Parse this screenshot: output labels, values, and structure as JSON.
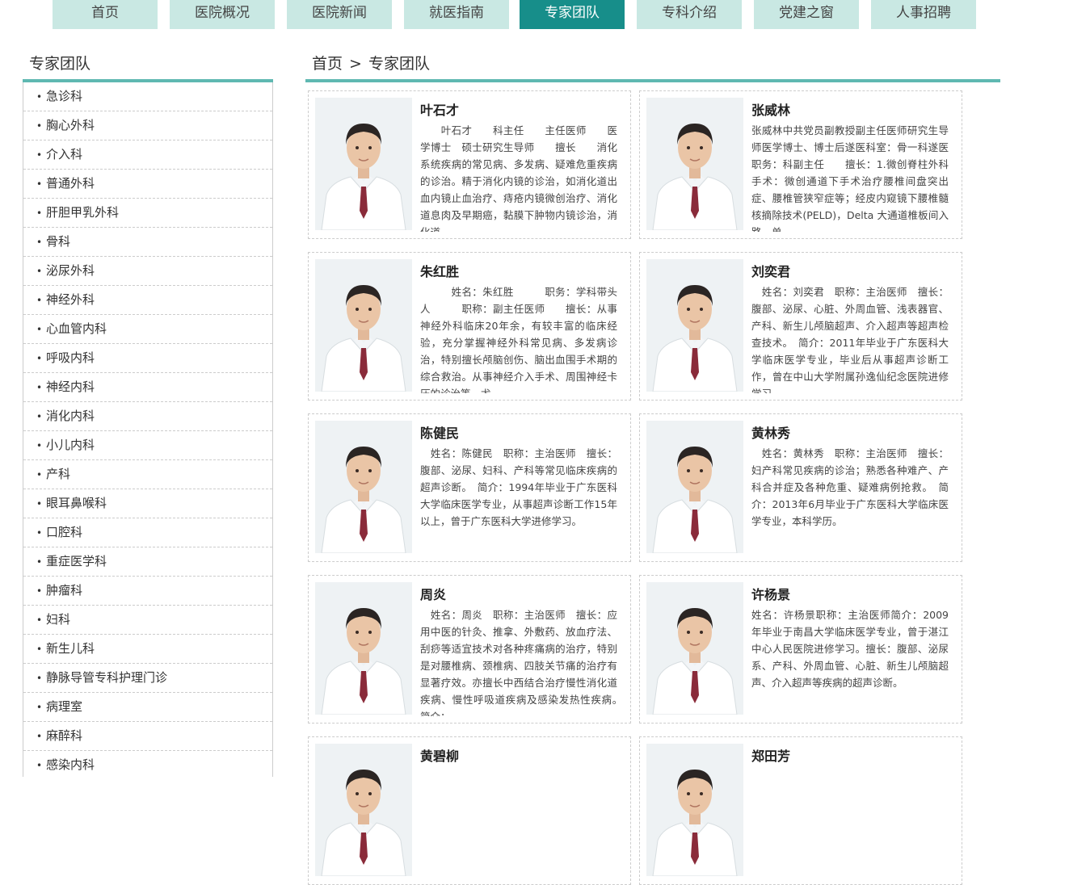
{
  "nav": {
    "items": [
      "首页",
      "医院概况",
      "医院新闻",
      "就医指南",
      "专家团队",
      "专科介绍",
      "党建之窗",
      "人事招聘"
    ],
    "active_index": 4
  },
  "sidebar": {
    "title": "专家团队",
    "items": [
      "急诊科",
      "胸心外科",
      "介入科",
      "普通外科",
      "肝胆甲乳外科",
      "骨科",
      "泌尿外科",
      "神经外科",
      "心血管内科",
      "呼吸内科",
      "神经内科",
      "消化内科",
      "小儿内科",
      "产科",
      "眼耳鼻喉科",
      "口腔科",
      "重症医学科",
      "肿瘤科",
      "妇科",
      "新生儿科",
      "静脉导管专科护理门诊",
      "病理室",
      "麻醉科",
      "感染内科"
    ]
  },
  "breadcrumb": {
    "home": "首页",
    "separator": ">",
    "current": "专家团队"
  },
  "doctors": [
    {
      "name": "叶石才",
      "desc": "　　叶石才　　科主任　　主任医师　　医学博士　硕士研究生导师　　擅长　　消化系统疾病的常见病、多发病、疑难危重疾病的诊治。精于消化内镜的诊治，如消化道出血内镜止血治疗、痔疮内镜微创治疗、消化道息肉及早期癌，黏膜下肿物内镜诊治，消化道"
    },
    {
      "name": "张威林",
      "desc": "张威林中共党员副教授副主任医师研究生导师医学博士、博士后遂医科室：骨一科遂医职务：科副主任　　擅长：1.微创脊柱外科手术：微创通道下手术治疗腰椎间盘突出症、腰椎管狭窄症等；经皮内窥镜下腰椎髓核摘除技术(PELD)，Delta 大通道椎板间入路，单"
    },
    {
      "name": "朱红胜",
      "desc": "　　　姓名：朱红胜　　　职务：学科带头人　　　职称：副主任医师　　擅长：从事神经外科临床20年余，有较丰富的临床经验，充分掌握神经外科常见病、多发病诊治，特别擅长颅脑创伤、脑出血围手术期的综合救治。从事神经介入手术、周围神经卡压的诊治等，尤"
    },
    {
      "name": "刘奕君",
      "desc": "　姓名：刘奕君　职称：主治医师　擅长：腹部、泌尿、心脏、外周血管、浅表器官、产科、新生儿颅脑超声、介入超声等超声检查技术。　简介：2011年毕业于广东医科大学临床医学专业，毕业后从事超声诊断工作，曾在中山大学附属孙逸仙纪念医院进修学习。"
    },
    {
      "name": "陈健民",
      "desc": "　姓名：陈健民　职称：主治医师　擅长：腹部、泌尿、妇科、产科等常见临床疾病的超声诊断。　简介：1994年毕业于广东医科大学临床医学专业，从事超声诊断工作15年以上，曾于广东医科大学进修学习。"
    },
    {
      "name": "黄林秀",
      "desc": "　姓名：黄林秀　职称：主治医师　擅长：妇产科常见疾病的诊治；熟悉各种难产、产科合并症及各种危重、疑难病例抢救。　简介：2013年6月毕业于广东医科大学临床医学专业，本科学历。"
    },
    {
      "name": "周炎",
      "desc": "　姓名：周炎　职称：主治医师　擅长：应用中医的针灸、推拿、外敷药、放血疗法、刮痧等适宜技术对各种疼痛病的治疗，特别是对腰椎病、颈椎病、四肢关节痛的治疗有显著疗效。亦擅长中西结合治疗慢性消化道疾病、慢性呼吸道疾病及感染发热性疾病。　简介："
    },
    {
      "name": "许杨景",
      "desc": "姓名：许杨景职称：主治医师简介：2009年毕业于南昌大学临床医学专业，曾于湛江中心人民医院进修学习。擅长：腹部、泌尿系、产科、外周血管、心脏、新生儿颅脑超声、介入超声等疾病的超声诊断。"
    },
    {
      "name": "黄碧柳",
      "desc": ""
    },
    {
      "name": "郑田芳",
      "desc": ""
    }
  ],
  "colors": {
    "accent": "#178e8a",
    "nav_bg": "#c9e8e3",
    "rule": "#5fb8b1"
  }
}
